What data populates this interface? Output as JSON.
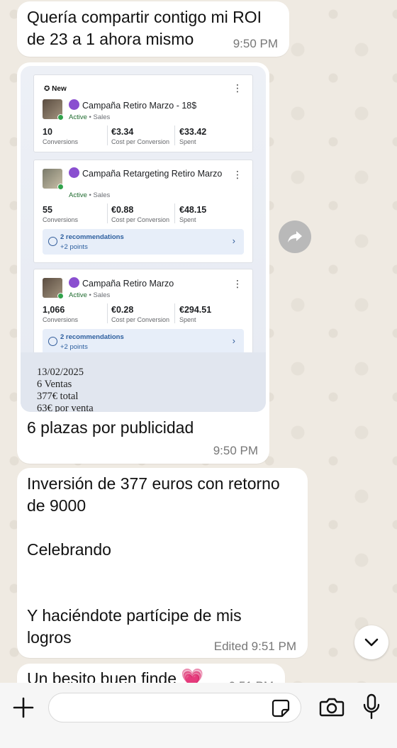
{
  "messages": [
    {
      "text": "Quería compartir contigo mi ROI\nde 23 a 1 ahora mismo",
      "time": "9:50 PM"
    },
    {
      "text": "6 plazas por publicidad",
      "time": "9:50 PM"
    },
    {
      "text": "Inversión de 377 euros con retorno\nde 9000\n\nCelebrando\n\n\nY haciéndote partícipe de mis\nlogros",
      "time": "Edited 9:51 PM"
    },
    {
      "text": "Un besito buen finde",
      "emoji": "💗",
      "time": "9:51 PM"
    }
  ],
  "screenshot": {
    "new_label": "New",
    "campaigns": [
      {
        "name": "Campaña Retiro Marzo - 18$",
        "status": "Active",
        "objective": "Sales",
        "conversions": "10",
        "cpc": "€3.34",
        "spent": "€33.42",
        "recommendations": null
      },
      {
        "name": "Campaña Retargeting Retiro Marzo",
        "status": "Active",
        "objective": "Sales",
        "conversions": "55",
        "cpc": "€0.88",
        "spent": "€48.15",
        "recommendations": {
          "title": "2 recommendations",
          "points": "+2 points"
        }
      },
      {
        "name": "Campaña Retiro Marzo",
        "status": "Active",
        "objective": "Sales",
        "conversions": "1,066",
        "cpc": "€0.28",
        "spent": "€294.51",
        "recommendations": {
          "title": "2 recommendations",
          "points": "+2 points"
        }
      }
    ],
    "labels": {
      "conversions": "Conversions",
      "cpc": "Cost per Conversion",
      "spent": "Spent",
      "separator": "•"
    },
    "caption": "13/02/2025\n6 Ventas\n377€ total\n63€ por venta"
  },
  "input": {
    "placeholder": ""
  },
  "colors": {
    "background": "#efeae2",
    "bubble": "#ffffff",
    "active_green": "#31a24c",
    "heart": "#e2468a"
  }
}
